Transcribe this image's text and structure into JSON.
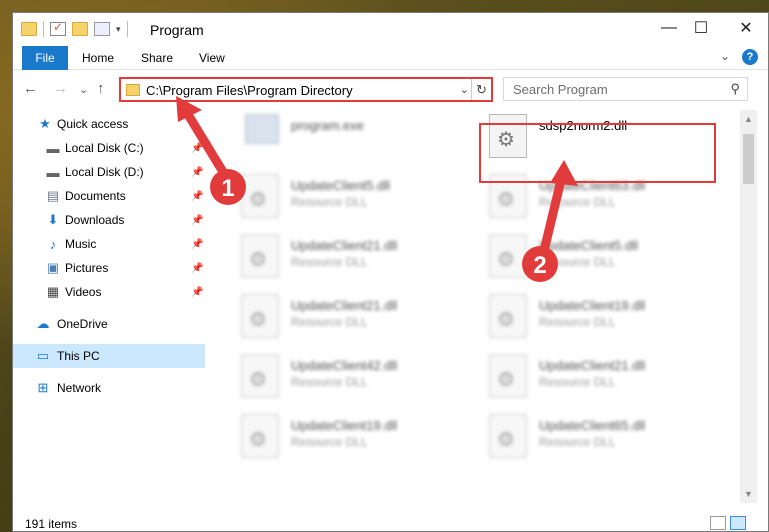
{
  "window": {
    "title": "Program",
    "minimize": "—",
    "maximize": "☐",
    "close": "✕"
  },
  "ribbon": {
    "file": "File",
    "home": "Home",
    "share": "Share",
    "view": "View",
    "expand": "⌄",
    "help": "?"
  },
  "nav": {
    "back": "←",
    "forward": "→",
    "recent": "⌄",
    "up": "↑",
    "address": "C:\\Program Files\\Program Directory",
    "refresh": "↻",
    "search_placeholder": "Search Program",
    "search_icon": "⚲"
  },
  "sidebar": {
    "items": [
      {
        "label": "Quick access",
        "icon": "★"
      },
      {
        "label": "Local Disk (C:)",
        "icon": "▬"
      },
      {
        "label": "Local Disk (D:)",
        "icon": "▬"
      },
      {
        "label": "Documents",
        "icon": "▤"
      },
      {
        "label": "Downloads",
        "icon": "⬇"
      },
      {
        "label": "Music",
        "icon": "♪"
      },
      {
        "label": "Pictures",
        "icon": "▣"
      },
      {
        "label": "Videos",
        "icon": "▦"
      },
      {
        "label": "OneDrive",
        "icon": "☁"
      },
      {
        "label": "This PC",
        "icon": "▭"
      },
      {
        "label": "Network",
        "icon": "⊞"
      }
    ]
  },
  "files": {
    "program_exe": "program.exe",
    "highlighted": {
      "name": "sdsp2norm2.dll"
    },
    "left": [
      {
        "name": "UpdateClient5.dll",
        "type": "Resource DLL"
      },
      {
        "name": "UpdateClient21.dll",
        "type": "Resource DLL"
      },
      {
        "name": "UpdateClient21.dll",
        "type": "Resource DLL"
      },
      {
        "name": "UpdateClient42.dll",
        "type": "Resource DLL"
      },
      {
        "name": "UpdateClient19.dll",
        "type": "Resource DLL"
      }
    ],
    "right": [
      {
        "name": "UpdateClient63.dll",
        "type": "Resource DLL"
      },
      {
        "name": "UpdateClient5.dll",
        "type": "Resource DLL"
      },
      {
        "name": "UpdateClient19.dll",
        "type": "Resource DLL"
      },
      {
        "name": "UpdateClient21.dll",
        "type": "Resource DLL"
      },
      {
        "name": "UpdateClient65.dll",
        "type": "Resource DLL"
      }
    ]
  },
  "status": {
    "count": "191 items"
  },
  "annotations": {
    "badge1": "1",
    "badge2": "2",
    "color": "#e23b3b"
  }
}
